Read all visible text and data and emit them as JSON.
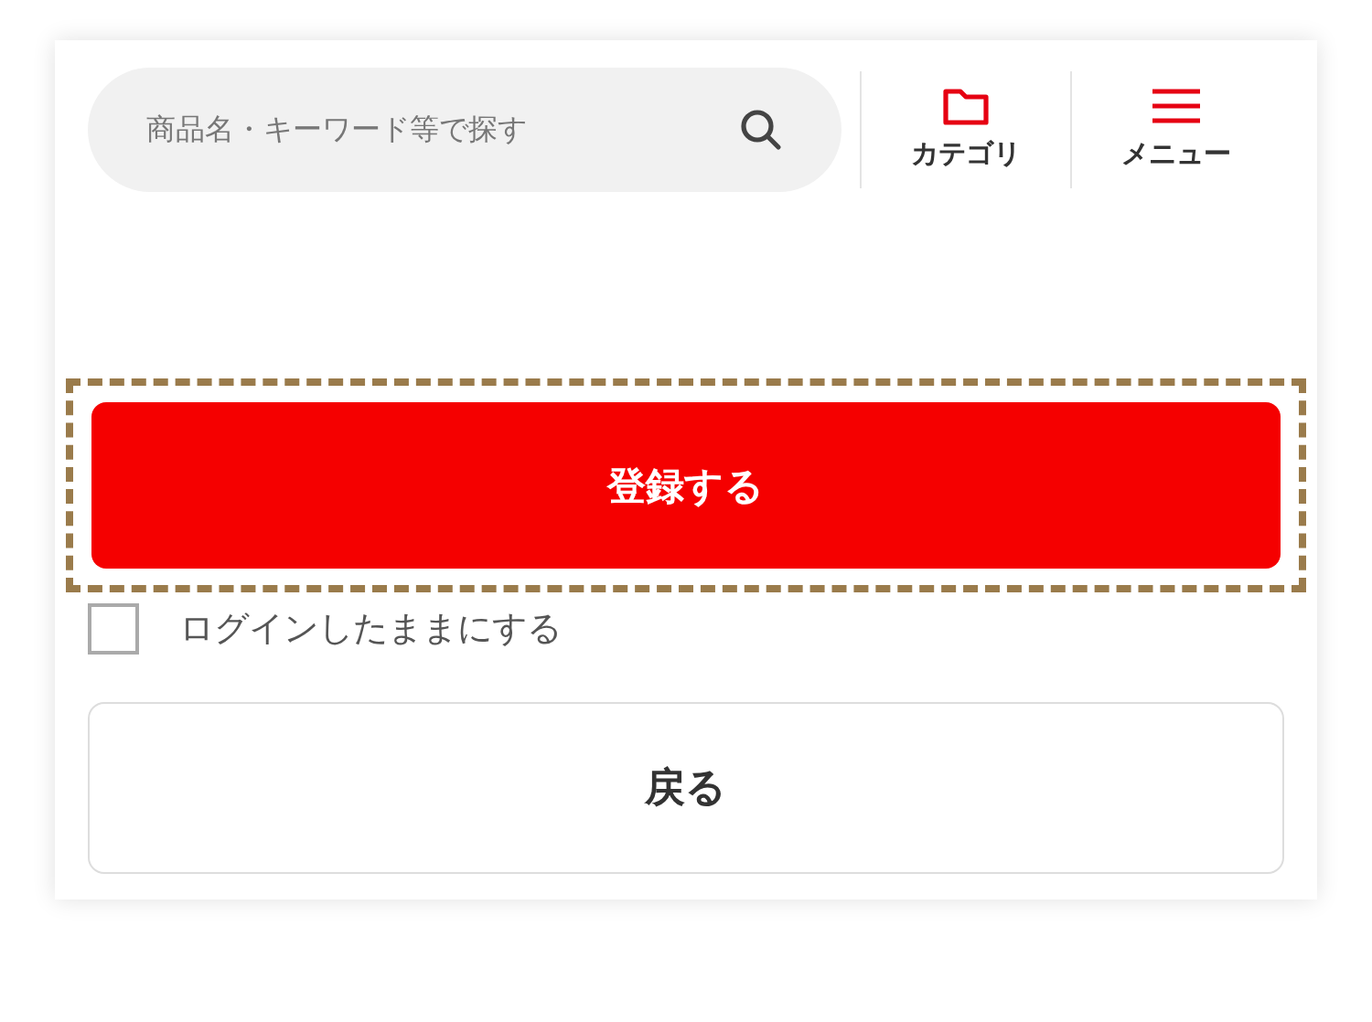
{
  "search": {
    "placeholder": "商品名・キーワード等で探す"
  },
  "nav": [
    {
      "kind": "folder",
      "label": "カテゴリ"
    },
    {
      "kind": "menu",
      "label": "メニュー"
    }
  ],
  "register_button": {
    "label": "登録する",
    "highlighted": true
  },
  "remember_login": {
    "label": "ログインしたままにする",
    "checked": false
  },
  "back_button": {
    "label": "戻る"
  }
}
